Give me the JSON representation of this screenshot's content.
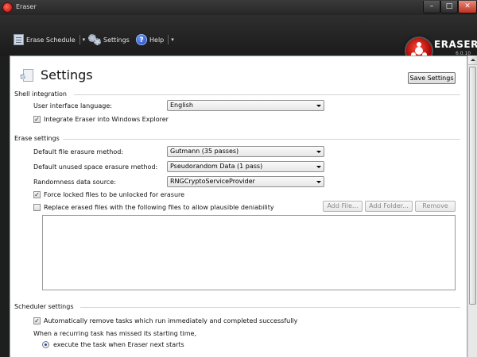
{
  "window": {
    "title": "Eraser"
  },
  "toolbar": {
    "erase_schedule_label": "Erase Schedule",
    "settings_label": "Settings",
    "help_label": "Help",
    "help_glyph": "?"
  },
  "logo": {
    "name": "ERASER",
    "version": "6.0.10"
  },
  "page": {
    "title": "Settings",
    "save_button": "Save Settings"
  },
  "shell": {
    "heading": "Shell integration",
    "language_label": "User interface language:",
    "language_value": "English",
    "integrate_label": "Integrate Eraser into Windows Explorer",
    "integrate_checked": true
  },
  "erase": {
    "heading": "Erase settings",
    "file_method_label": "Default file erasure method:",
    "file_method_value": "Gutmann (35 passes)",
    "unused_method_label": "Default unused space erasure method:",
    "unused_method_value": "Pseudorandom Data (1 pass)",
    "random_label": "Randomness data source:",
    "random_value": "RNGCryptoServiceProvider",
    "force_unlock_label": "Force locked files to be unlocked for erasure",
    "force_unlock_checked": true,
    "replace_label": "Replace erased files with the following files to allow plausible deniability",
    "replace_checked": false,
    "add_file_button": "Add File...",
    "add_folder_button": "Add Folder...",
    "remove_button": "Remove"
  },
  "scheduler": {
    "heading": "Scheduler settings",
    "auto_remove_label": "Automatically remove tasks which run immediately and completed successfully",
    "auto_remove_checked": true,
    "missed_label": "When a recurring task has missed its starting time,",
    "execute_next_label": "execute the task when Eraser next starts"
  },
  "icons": {
    "app": "eraser-app-icon",
    "schedule": "schedule-icon",
    "settings": "gears-icon",
    "help": "help-icon",
    "page": "settings-page-icon",
    "checkmark_glyph": "✓",
    "minimize_glyph": "–",
    "maximize_glyph": "□",
    "close_glyph": "✕",
    "dropdown_glyph": "▾"
  },
  "colors": {
    "accent_red": "#c0321e",
    "toolbar_bg": "#1e1e1e"
  }
}
